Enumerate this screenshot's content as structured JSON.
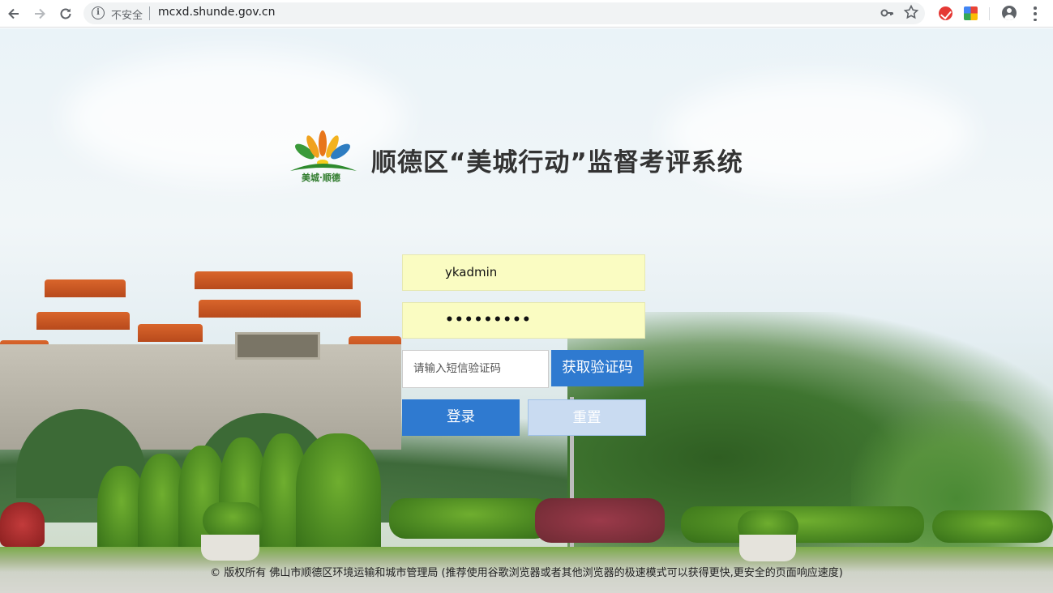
{
  "browser": {
    "url": "mcxd.shunde.gov.cn",
    "security_label": "不安全",
    "icons": {
      "back": "arrow-left-icon",
      "forward": "arrow-right-icon",
      "reload": "reload-icon",
      "info": "info-icon",
      "key": "key-icon",
      "star": "star-icon",
      "account": "account-icon",
      "menu": "menu-dots-icon"
    }
  },
  "header": {
    "logo_caption": "美城·顺德",
    "title": "顺德区“美城行动”监督考评系统"
  },
  "login": {
    "username_value": "ykadmin",
    "password_value": "•••••••••",
    "sms_placeholder": "请输入短信验证码",
    "get_code_label": "获取验证码",
    "login_label": "登录",
    "reset_label": "重置",
    "colors": {
      "primary": "#2f7ad0",
      "autofill": "#fafcc2",
      "reset": "#c9dbf1"
    }
  },
  "footer": {
    "text": "© 版权所有 佛山市顺德区环境运输和城市管理局 (推荐使用谷歌浏览器或者其他浏览器的极速模式可以获得更快,更安全的页面响应速度)"
  }
}
